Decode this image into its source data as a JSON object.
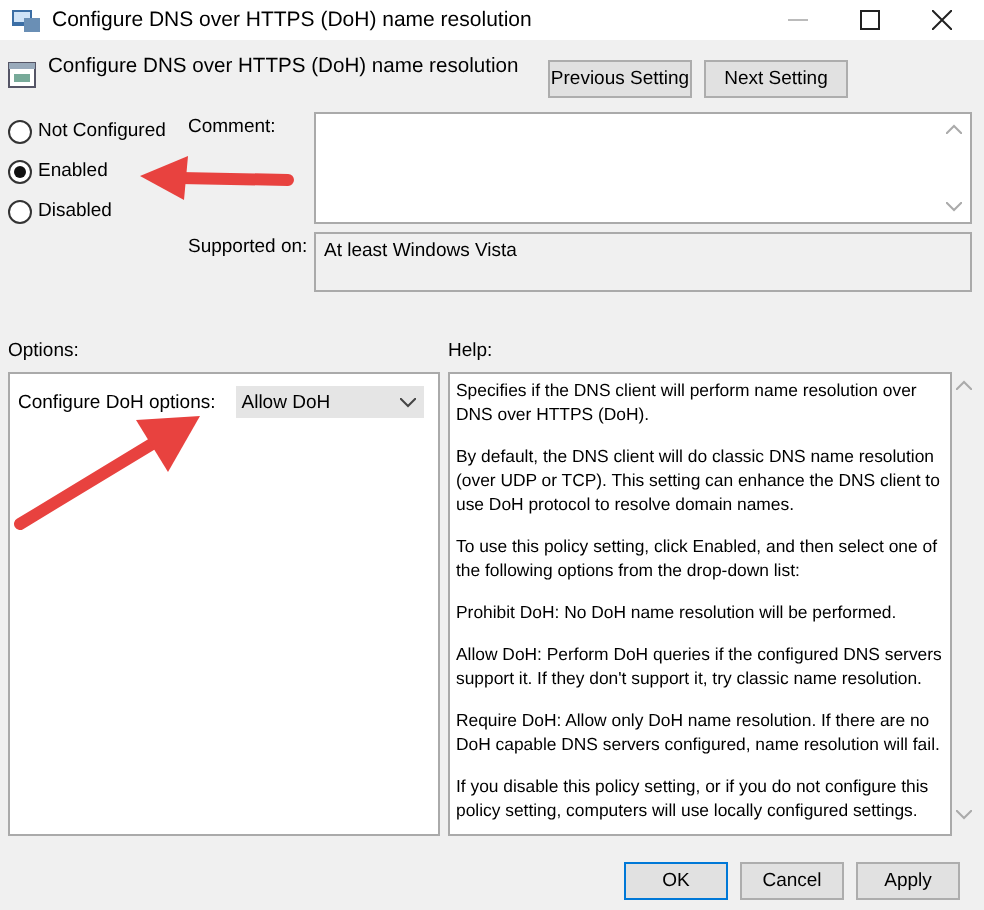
{
  "window": {
    "title": "Configure DNS over HTTPS (DoH) name resolution"
  },
  "header": {
    "title": "Configure DNS over HTTPS (DoH) name resolution",
    "buttons": [
      "Previous Setting",
      "Next Setting"
    ]
  },
  "states": [
    {
      "label": "Not Configured",
      "selected": false
    },
    {
      "label": "Enabled",
      "selected": true
    },
    {
      "label": "Disabled",
      "selected": false
    }
  ],
  "comment": {
    "label": "Comment:"
  },
  "supported_on": {
    "label": "Supported on:",
    "value": "At least Windows Vista"
  },
  "options": {
    "label": "Options:",
    "dropdown": {
      "label": "Configure DoH options:",
      "value": "Allow DoH"
    }
  },
  "help": {
    "label": "Help:",
    "paragraphs": [
      "Specifies if the DNS client will perform name resolution over DNS over HTTPS (DoH).",
      "By default, the DNS client will do classic DNS name resolution (over UDP or TCP). This setting can enhance the DNS client to use DoH protocol to resolve domain names.",
      "To use this policy setting, click Enabled, and then select one of the following options from the drop-down list:",
      "Prohibit DoH: No DoH name resolution will be performed.",
      "Allow DoH: Perform DoH queries if the configured DNS servers support it. If they don't support it, try classic name resolution.",
      "Require DoH: Allow only DoH name resolution. If there are no DoH capable DNS servers configured, name resolution will fail.",
      "If you disable this policy setting, or if you do not configure this policy setting, computers will use locally configured settings."
    ]
  },
  "buttons": [
    {
      "label": "OK",
      "default": true
    },
    {
      "label": "Cancel",
      "default": false
    },
    {
      "label": "Apply",
      "default": false
    }
  ]
}
